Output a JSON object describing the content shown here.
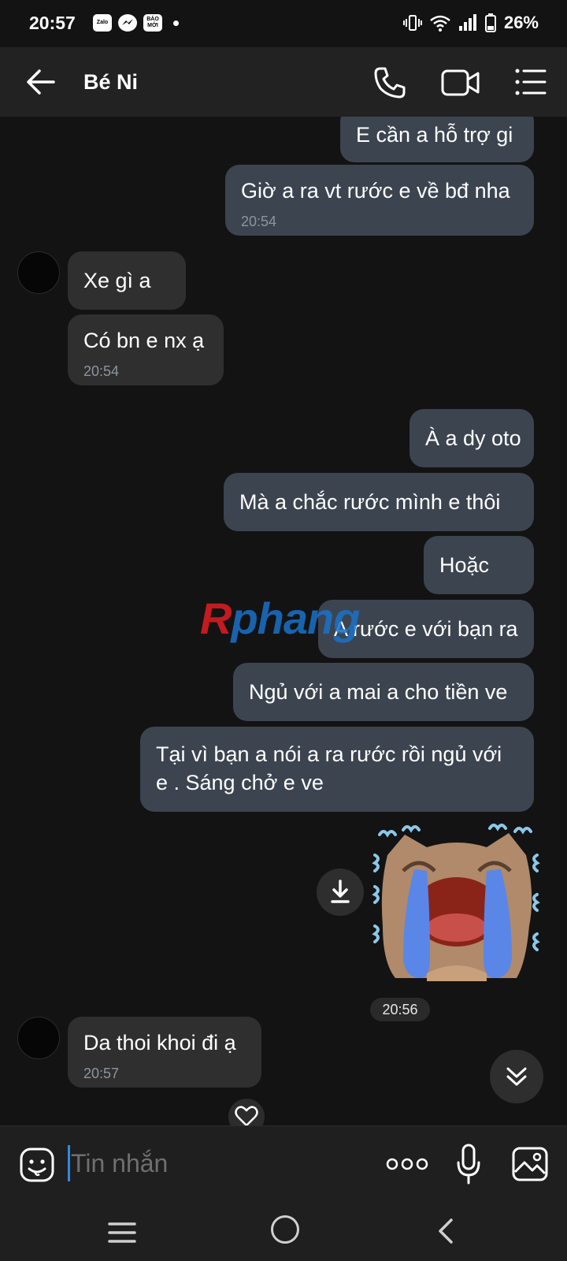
{
  "status_bar": {
    "time": "20:57",
    "apps": [
      "Zalo",
      "messenger-icon",
      "BÁO MỚI"
    ],
    "battery": "26%"
  },
  "header": {
    "title": "Bé Ni"
  },
  "messages": [
    {
      "dir": "out",
      "text": "E cần a hỗ trợ gi",
      "time": ""
    },
    {
      "dir": "out",
      "text": "Giờ a ra vt rước e về bđ nha",
      "time": "20:54"
    },
    {
      "dir": "in",
      "text": "Xe gì a",
      "time": ""
    },
    {
      "dir": "in",
      "text": "Có bn e nx ạ",
      "time": "20:54"
    },
    {
      "dir": "out",
      "text": "À a dy oto",
      "time": ""
    },
    {
      "dir": "out",
      "text": "Mà a chắc rước mình e thôi",
      "time": ""
    },
    {
      "dir": "out",
      "text": "Hoặc",
      "time": ""
    },
    {
      "dir": "out",
      "text": "A rước e với bạn ra",
      "time": ""
    },
    {
      "dir": "out",
      "text": "Ngủ với a mai a cho tiền ve",
      "time": ""
    },
    {
      "dir": "out",
      "text_line1": "Tại vì bạn a nói a ra rước rồi ngủ với",
      "text_line2": "e . Sáng chở e ve",
      "time": ""
    },
    {
      "dir": "out",
      "type": "sticker",
      "sticker": "crying-cat-sticker",
      "time": "20:56"
    },
    {
      "dir": "in",
      "text": "Da thoi khoi đi ạ",
      "time": "20:57"
    }
  ],
  "watermark": {
    "r": "R",
    "rest": "phang"
  },
  "composer": {
    "placeholder": "Tin nhắn"
  },
  "colors": {
    "background": "#131313",
    "header": "#222222",
    "outgoing_bubble": "#3c4450",
    "incoming_bubble": "#2f2f2f",
    "caret": "#2f8ae6"
  }
}
